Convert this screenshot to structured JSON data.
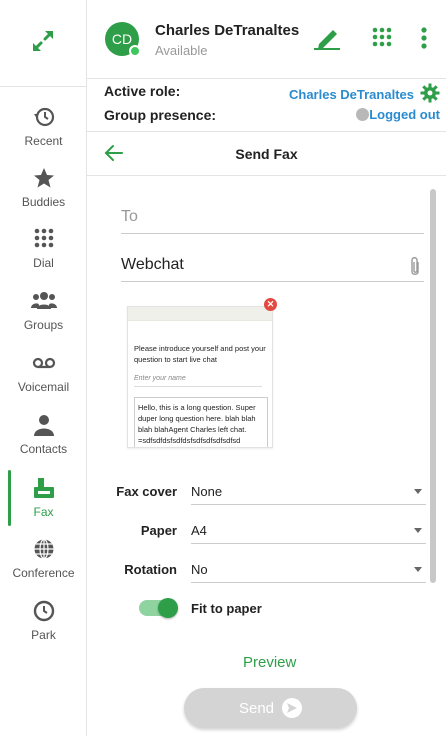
{
  "colors": {
    "accent": "#2e9e49",
    "link": "#2a8ccf",
    "danger": "#e34a3f",
    "muted": "#999999"
  },
  "nav": {
    "expand_icon": "expand-arrows-icon",
    "items": [
      {
        "label": "Recent",
        "icon": "history-icon"
      },
      {
        "label": "Buddies",
        "icon": "star-icon"
      },
      {
        "label": "Dial",
        "icon": "dialpad-icon"
      },
      {
        "label": "Groups",
        "icon": "groups-icon"
      },
      {
        "label": "Voicemail",
        "icon": "voicemail-icon"
      },
      {
        "label": "Contacts",
        "icon": "contact-icon"
      },
      {
        "label": "Fax",
        "icon": "fax-icon",
        "active": true
      },
      {
        "label": "Conference",
        "icon": "globe-icon"
      },
      {
        "label": "Park",
        "icon": "park-clock-icon"
      }
    ]
  },
  "header": {
    "avatar_initials": "CD",
    "user_name": "Charles DeTranaltes",
    "status": "Available"
  },
  "role": {
    "active_role_label": "Active role:",
    "active_role_value": "Charles DeTranaltes",
    "group_presence_label": "Group presence:",
    "group_presence_value": "Logged out"
  },
  "panel": {
    "title": "Send Fax"
  },
  "form": {
    "to_placeholder": "To",
    "subject_value": "Webchat",
    "preview_text_1": "Please introduce yourself and post your question to start live chat",
    "preview_placeholder": "Enter your name",
    "preview_text_2": "Hello, this is a long question. Super duper long question here. blah blah blah blahAgent Charles left chat. =sdfsdfdsfsdfdsfsdfsdfsdfsdfsd",
    "fax_cover_label": "Fax cover",
    "fax_cover_value": "None",
    "paper_label": "Paper",
    "paper_value": "A4",
    "rotation_label": "Rotation",
    "rotation_value": "No",
    "fit_label": "Fit to paper",
    "fit_enabled": true,
    "preview_label": "Preview",
    "send_label": "Send"
  }
}
